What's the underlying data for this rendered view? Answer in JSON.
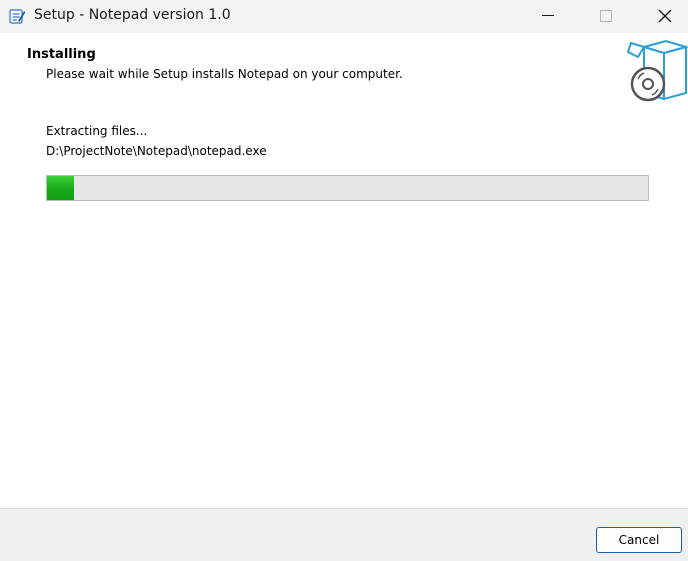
{
  "window": {
    "title": "Setup - Notepad version 1.0",
    "app_icon": "notepad-icon",
    "controls": [
      "minimize-icon",
      "maximize-icon",
      "close-icon"
    ]
  },
  "header": {
    "title": "Installing",
    "subtitle": "Please wait while Setup installs Notepad on your computer.",
    "icon": "install-box-disc-icon"
  },
  "main": {
    "status_text": "Extracting files...",
    "current_file": "D:\\ProjectNote\\Notepad\\notepad.exe",
    "progress_fraction": 0.045
  },
  "footer": {
    "cancel_label": "Cancel"
  },
  "colors": {
    "progress": "#18a818",
    "accent_border": "#1f5fa8",
    "icon_blue": "#2a9fd8"
  }
}
